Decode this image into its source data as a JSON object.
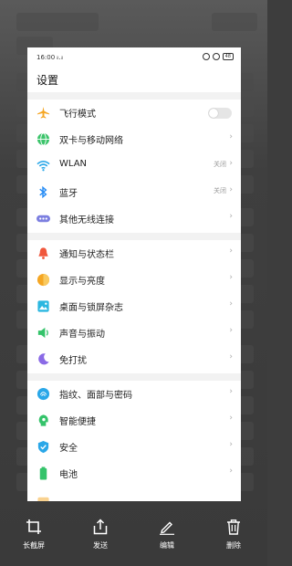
{
  "status_bar": {
    "time": "16:00",
    "signal": "ᵢₗ.ᵢₗ",
    "battery": "48"
  },
  "page_title": "设置",
  "settings": [
    {
      "label": "飞行模式",
      "icon": "airplane-icon",
      "color": "#f5a623",
      "control": "toggle"
    },
    {
      "label": "双卡与移动网络",
      "icon": "globe-icon",
      "color": "#3cc46b",
      "control": "chevron"
    },
    {
      "label": "WLAN",
      "icon": "wifi-icon",
      "color": "#2aa7e8",
      "value": "关闭",
      "control": "chevron"
    },
    {
      "label": "蓝牙",
      "icon": "bluetooth-icon",
      "color": "#2a8ef5",
      "value": "关闭",
      "control": "chevron"
    },
    {
      "label": "其他无线连接",
      "icon": "more-dots-icon",
      "color": "#7c7fe0",
      "control": "chevron"
    },
    {
      "label": "通知与状态栏",
      "icon": "bell-icon",
      "color": "#f0573c",
      "control": "chevron"
    },
    {
      "label": "显示与亮度",
      "icon": "brightness-icon",
      "color": "#f5a623",
      "control": "chevron"
    },
    {
      "label": "桌面与锁屏杂志",
      "icon": "wallpaper-icon",
      "color": "#2bb7e0",
      "control": "chevron"
    },
    {
      "label": "声音与振动",
      "icon": "speaker-icon",
      "color": "#34c36a",
      "control": "chevron"
    },
    {
      "label": "免打扰",
      "icon": "moon-icon",
      "color": "#8a6ae6",
      "control": "chevron"
    },
    {
      "label": "指纹、面部与密码",
      "icon": "fingerprint-icon",
      "color": "#2aa7e8",
      "control": "chevron"
    },
    {
      "label": "智能便捷",
      "icon": "assistant-icon",
      "color": "#34c36a",
      "control": "chevron"
    },
    {
      "label": "安全",
      "icon": "shield-icon",
      "color": "#2aa7e8",
      "control": "chevron"
    },
    {
      "label": "电池",
      "icon": "battery-icon",
      "color": "#34c36a",
      "control": "chevron"
    }
  ],
  "toolbar": [
    {
      "label": "长截屏",
      "icon": "crop-icon"
    },
    {
      "label": "发送",
      "icon": "share-icon"
    },
    {
      "label": "编辑",
      "icon": "edit-icon"
    },
    {
      "label": "删除",
      "icon": "trash-icon"
    }
  ]
}
